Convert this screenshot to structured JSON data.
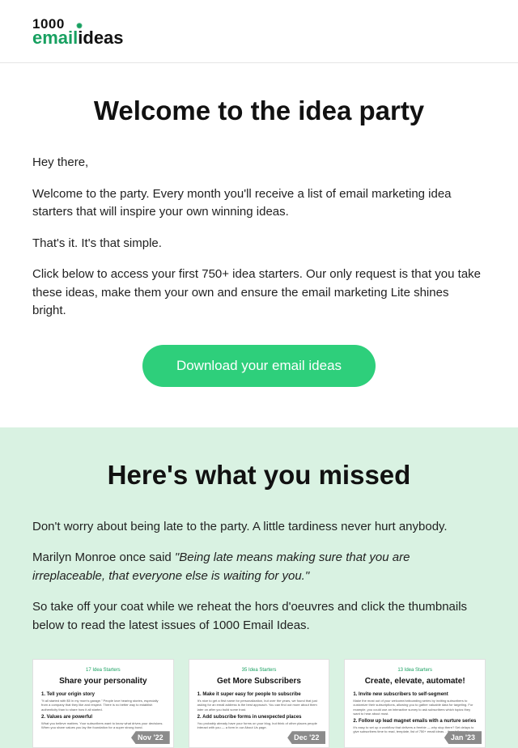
{
  "logo": {
    "top": "1000",
    "bottom_a": "email",
    "bottom_b": "ideas"
  },
  "hero": {
    "title": "Welcome to the idea party",
    "greeting": "Hey there,",
    "p1": "Welcome to the party. Every month you'll receive a list of email marketing idea starters that will inspire your own winning ideas.",
    "p2": "That's it. It's that simple.",
    "p3": "Click below to access your first 750+ idea starters. Our only request is that you take these ideas, make them your own and ensure the email marketing Lite shines bright.",
    "cta": "Download your email ideas"
  },
  "missed": {
    "title": "Here's what you missed",
    "p1": "Don't worry about being late to the party. A little tardiness never hurt anybody.",
    "p2a": "Marilyn Monroe once said ",
    "p2b": "\"Being late means making sure that you are irreplaceable, that everyone else is waiting for you.\"",
    "p3": "So take off your coat while we reheat the hors d'oeuvres and click the thumbnails below to read the latest issues of 1000 Email Ideas."
  },
  "thumbs": [
    {
      "tag": "17 Idea Starters",
      "title": "Share your personality",
      "sub1": "1. Tell your origin story",
      "text1": "\"It all started with $5 in my mom's garage.\" People love hearing stories, especially from a company that they like and respect. There is no better way to establish authenticity than to share how it all started.",
      "sub2": "2. Values are powerful",
      "text2": "What you believe matters. Your subscribers want to know what drives your decisions. When you share values you lay the foundation for a super strong bond.",
      "ribbon": "Nov '22"
    },
    {
      "tag": "35 Idea Starters",
      "title": "Get More Subscribers",
      "sub1": "1. Make it super easy for people to subscribe",
      "text1": "It's nice to get a first name for personalization, but over the years, we found that just asking for an email address is the best approach. You can find out more about them later on after you build some trust.",
      "sub2": "2. Add subscribe forms in unexpected places",
      "text2": "You probably already have your forms on your blog, but think of other places people interact with you — a form in our About Us page.",
      "ribbon": "Dec '22"
    },
    {
      "tag": "13 Idea Starters",
      "title": "Create, elevate, automate!",
      "sub1": "1. Invite new subscribers to self-segment",
      "text1": "Make the most out of your welcome/onboarding series by inviting subscribers to customize their subscriptions, allowing you to gather valuable data for targeting. For example, you could use an interactive survey to ask subscribers which topics they want to hear about most.",
      "sub2": "2. Follow up lead magnet emails with a nurture series",
      "text2": "It's easy to set up a workflow that delivers a freebie — why stop there? Set delays to give subscribers time to read, template, list of 750+ email ideas… then follow up.",
      "ribbon": "Jan '23"
    }
  ]
}
